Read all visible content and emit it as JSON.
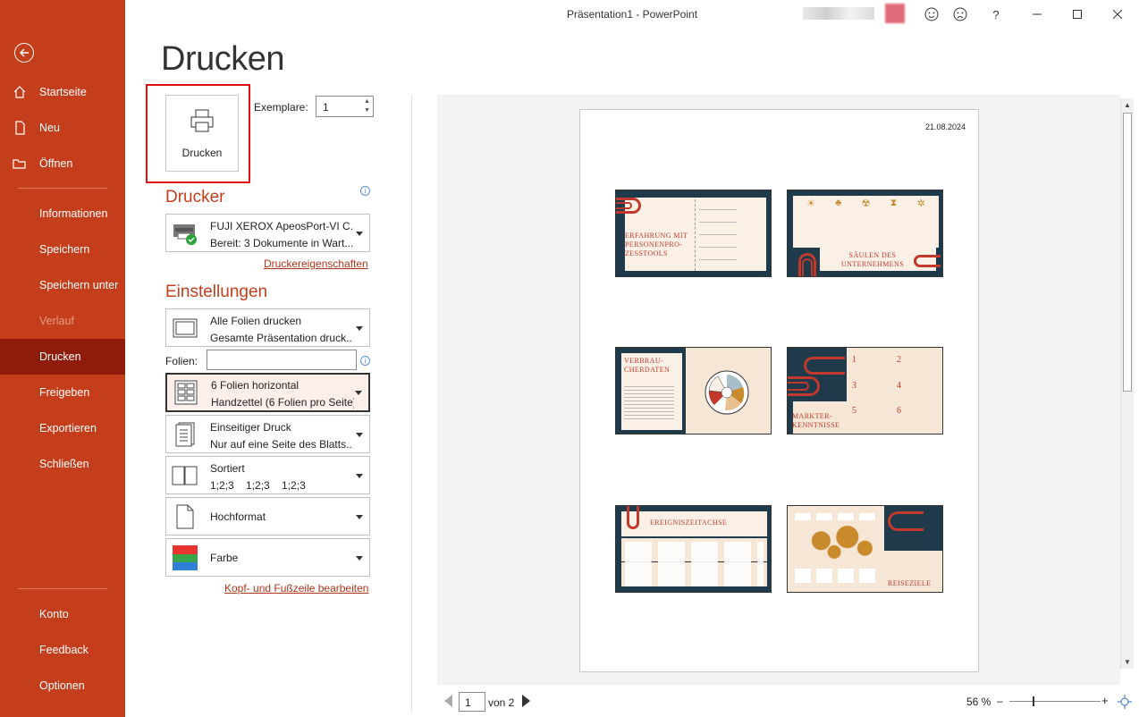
{
  "window": {
    "title": "Präsentation1  -  PowerPoint"
  },
  "sidebar": {
    "items": [
      {
        "label": "Startseite",
        "icon": "home-icon"
      },
      {
        "label": "Neu",
        "icon": "new-file-icon"
      },
      {
        "label": "Öffnen",
        "icon": "folder-open-icon"
      },
      {
        "label": "Informationen"
      },
      {
        "label": "Speichern"
      },
      {
        "label": "Speichern unter"
      },
      {
        "label": "Verlauf"
      },
      {
        "label": "Drucken"
      },
      {
        "label": "Freigeben"
      },
      {
        "label": "Exportieren"
      },
      {
        "label": "Schließen"
      },
      {
        "label": "Konto"
      },
      {
        "label": "Feedback"
      },
      {
        "label": "Optionen"
      }
    ]
  },
  "print": {
    "heading": "Drucken",
    "button_label": "Drucken",
    "copies_label": "Exemplare:",
    "copies_value": "1",
    "printer_heading": "Drucker",
    "printer_name": "FUJI XEROX ApeosPort-VI C...",
    "printer_status": "Bereit: 3 Dokumente in Wart...",
    "printer_properties_link": "Druckereigenschaften",
    "settings_heading": "Einstellungen",
    "slides_label": "Folien:",
    "slides_value": "",
    "settings": [
      {
        "l1": "Alle Folien drucken",
        "l2": "Gesamte Präsentation druck..."
      },
      {
        "l1": "6 Folien horizontal",
        "l2": "Handzettel (6 Folien pro Seite)"
      },
      {
        "l1": "Einseitiger Druck",
        "l2": "Nur auf eine Seite des Blatts..."
      },
      {
        "l1": "Sortiert",
        "l2": "1;2;3    1;2;3    1;2;3"
      },
      {
        "l1": "Hochformat"
      },
      {
        "l1": "Farbe"
      }
    ],
    "header_footer_link": "Kopf- und Fußzeile bearbeiten"
  },
  "preview": {
    "date": "21.08.2024",
    "slides": [
      {
        "title": "ERFAHRUNG MIT PERSONENPRO-ZESSTOOLS"
      },
      {
        "title": "SÄULEN DES UNTERNEHMENS"
      },
      {
        "title": "VERBRAU-CHERDATEN"
      },
      {
        "title": "MARKTER-KENNTNISSE",
        "numbers": [
          "1",
          "2",
          "3",
          "4",
          "5",
          "6"
        ]
      },
      {
        "title": "EREIGNISZEITACHSE"
      },
      {
        "title": "REISEZIELE"
      }
    ],
    "page_current": "1",
    "page_of": "von 2",
    "zoom": "56 %",
    "zoom_minus": "–",
    "zoom_plus": "+"
  },
  "colors": {
    "accent": "#c43e1c",
    "active": "#8f1b0a",
    "slide_dark": "#1f3a4a",
    "slide_red": "#c0392b",
    "slide_bg": "#fbf0e6"
  }
}
